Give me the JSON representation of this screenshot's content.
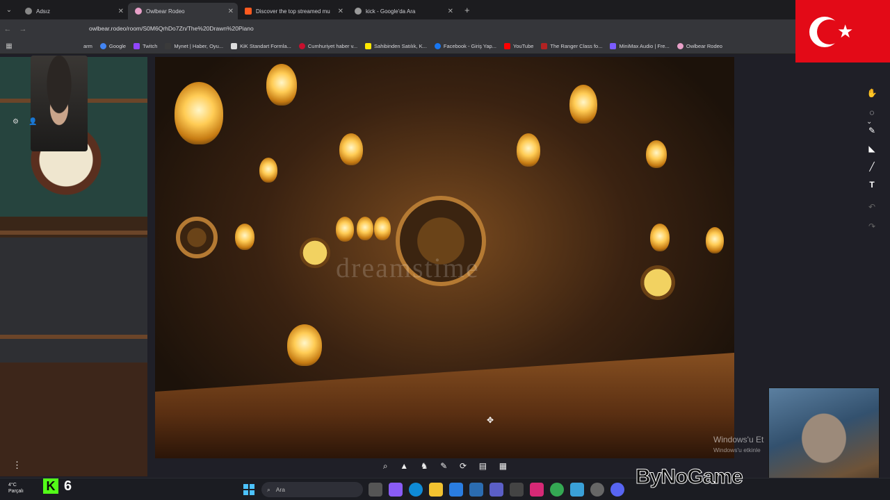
{
  "tabs": [
    {
      "title": "Adsız",
      "fav_color": "#888888",
      "active": false
    },
    {
      "title": "Owlbear Rodeo",
      "fav_color": "#e8a0c8",
      "active": true
    },
    {
      "title": "Discover the top streamed mu",
      "fav_color": "#ff5a1f",
      "active": false
    },
    {
      "title": "kick - Google'da Ara",
      "fav_color": "#9a9a9a",
      "active": false
    }
  ],
  "address": {
    "url": "owlbear.rodeo/room/S0M6QrhDo7Zn/The%20Drawn%20Piano"
  },
  "bookmarks": [
    {
      "label": "arm",
      "color": "#c0392b"
    },
    {
      "label": "Google",
      "color": "#4285f4"
    },
    {
      "label": "Twitch",
      "color": "#9146ff"
    },
    {
      "label": "Mynet | Haber, Oyu...",
      "color": "#3a3a3a"
    },
    {
      "label": "KiK Standart Formla...",
      "color": "#dddddd"
    },
    {
      "label": "Cumhuriyet haber v...",
      "color": "#c8102e"
    },
    {
      "label": "Sahibinden Satılık, K...",
      "color": "#ffe800"
    },
    {
      "label": "Facebook - Giriş Yap...",
      "color": "#1877f2"
    },
    {
      "label": "YouTube",
      "color": "#ff0000"
    },
    {
      "label": "The Ranger Class fo...",
      "color": "#b22222"
    },
    {
      "label": "MiniMax Audio | Fre...",
      "color": "#7b5cff"
    },
    {
      "label": "Owlbear Rodeo",
      "color": "#e8a0c8"
    }
  ],
  "watermark": "dreamstime",
  "windows_activation": {
    "title": "Windows'u Et",
    "subtitle": "Windows'u etkinle"
  },
  "taskbar": {
    "weather_temp": "4°C",
    "weather_desc": "Parçalı",
    "kick_count": "6",
    "search_placeholder": "Ara"
  },
  "logo_text": "ByNoGame",
  "right_toolbar_icons": [
    "hand-icon",
    "lasso-icon",
    "pencil-icon",
    "measure-icon",
    "brush-icon",
    "text-icon",
    "undo-icon",
    "redo-icon"
  ],
  "bottom_toolbar_icons": [
    "zoom-icon",
    "bell-icon",
    "horse-icon",
    "draw-icon",
    "rotate-icon",
    "note-icon",
    "grid-icon"
  ]
}
